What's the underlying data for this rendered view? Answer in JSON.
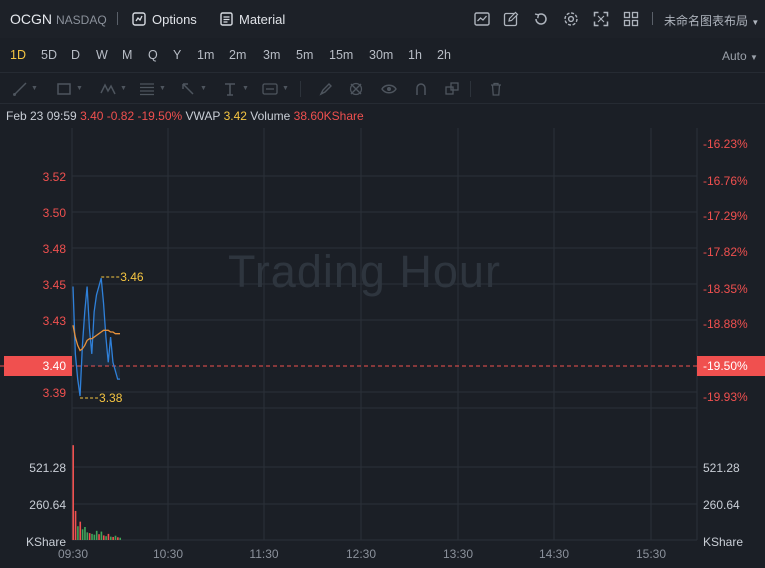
{
  "header": {
    "ticker": "OCGN",
    "exchange": "NASDAQ",
    "options_label": "Options",
    "material_label": "Material",
    "layout_name": "未命名图表布局"
  },
  "toolbar_icons": [
    "indicator-icon",
    "edit-icon",
    "replay-icon",
    "settings-icon",
    "fullscreen-icon",
    "grid-layout-icon"
  ],
  "periods": [
    {
      "label": "1D",
      "active": true
    },
    {
      "label": "5D"
    },
    {
      "label": "D"
    },
    {
      "label": "W"
    },
    {
      "label": "M"
    },
    {
      "label": "Q"
    },
    {
      "label": "Y"
    },
    {
      "label": "1m"
    },
    {
      "label": "2m"
    },
    {
      "label": "3m"
    },
    {
      "label": "5m"
    },
    {
      "label": "15m"
    },
    {
      "label": "30m"
    },
    {
      "label": "1h"
    },
    {
      "label": "2h"
    }
  ],
  "auto_label": "Auto",
  "quote": {
    "datetime": "Feb 23 09:59",
    "price": "3.40",
    "change": "-0.82",
    "change_pct": "-19.50%",
    "vwap_label": "VWAP",
    "vwap": "3.42",
    "volume_label": "Volume",
    "volume": "38.60KShare"
  },
  "watermark": "Trading Hour",
  "colors": {
    "price_line": "#2f80d9",
    "vwap_line": "#e8913a",
    "down": "#f0504f",
    "up": "#3fa55a",
    "accent": "#f5c542",
    "grid": "#2b3139"
  },
  "chart_data": {
    "type": "line",
    "price_axis_labels": [
      "3.52",
      "3.50",
      "3.48",
      "3.45",
      "3.43",
      "3.40",
      "3.39"
    ],
    "pct_axis_labels": [
      "-16.23%",
      "-16.76%",
      "-17.29%",
      "-17.82%",
      "-18.35%",
      "-18.88%",
      "-19.50%",
      "-19.93%"
    ],
    "current_price": "3.40",
    "current_pct": "-19.50%",
    "high_marker": "3.46",
    "low_marker": "3.38",
    "time_labels": [
      "09:30",
      "10:30",
      "11:30",
      "12:30",
      "13:30",
      "14:30",
      "15:30"
    ],
    "volume_axis_labels": [
      "521.28",
      "260.64",
      "KShare"
    ],
    "price_series": [
      [
        0,
        3.455
      ],
      [
        1,
        3.415
      ],
      [
        2,
        3.4
      ],
      [
        3,
        3.39
      ],
      [
        4,
        3.42
      ],
      [
        5,
        3.44
      ],
      [
        6,
        3.455
      ],
      [
        7,
        3.43
      ],
      [
        8,
        3.415
      ],
      [
        9,
        3.44
      ],
      [
        10,
        3.45
      ],
      [
        11,
        3.455
      ],
      [
        12,
        3.46
      ],
      [
        13,
        3.445
      ],
      [
        14,
        3.425
      ],
      [
        15,
        3.41
      ],
      [
        16,
        3.425
      ],
      [
        17,
        3.41
      ],
      [
        18,
        3.405
      ],
      [
        19,
        3.4
      ],
      [
        20,
        3.4
      ]
    ],
    "vwap_series": [
      [
        0,
        3.432
      ],
      [
        1,
        3.425
      ],
      [
        2,
        3.42
      ],
      [
        3,
        3.417
      ],
      [
        4,
        3.418
      ],
      [
        5,
        3.42
      ],
      [
        6,
        3.423
      ],
      [
        7,
        3.424
      ],
      [
        8,
        3.424
      ],
      [
        9,
        3.425
      ],
      [
        10,
        3.426
      ],
      [
        11,
        3.427
      ],
      [
        12,
        3.428
      ],
      [
        13,
        3.429
      ],
      [
        14,
        3.429
      ],
      [
        15,
        3.429
      ],
      [
        16,
        3.428
      ],
      [
        17,
        3.428
      ],
      [
        18,
        3.427
      ],
      [
        19,
        3.427
      ],
      [
        20,
        3.427
      ]
    ],
    "volume_series": [
      {
        "m": 0,
        "v": 620,
        "dir": "down"
      },
      {
        "m": 1,
        "v": 190,
        "dir": "down"
      },
      {
        "m": 2,
        "v": 90,
        "dir": "up"
      },
      {
        "m": 3,
        "v": 120,
        "dir": "down"
      },
      {
        "m": 4,
        "v": 70,
        "dir": "up"
      },
      {
        "m": 5,
        "v": 85,
        "dir": "up"
      },
      {
        "m": 6,
        "v": 50,
        "dir": "up"
      },
      {
        "m": 7,
        "v": 45,
        "dir": "down"
      },
      {
        "m": 8,
        "v": 40,
        "dir": "up"
      },
      {
        "m": 9,
        "v": 35,
        "dir": "up"
      },
      {
        "m": 10,
        "v": 60,
        "dir": "up"
      },
      {
        "m": 11,
        "v": 38,
        "dir": "down"
      },
      {
        "m": 12,
        "v": 55,
        "dir": "up"
      },
      {
        "m": 13,
        "v": 30,
        "dir": "down"
      },
      {
        "m": 14,
        "v": 25,
        "dir": "up"
      },
      {
        "m": 15,
        "v": 40,
        "dir": "down"
      },
      {
        "m": 16,
        "v": 22,
        "dir": "up"
      },
      {
        "m": 17,
        "v": 20,
        "dir": "down"
      },
      {
        "m": 18,
        "v": 28,
        "dir": "up"
      },
      {
        "m": 19,
        "v": 18,
        "dir": "down"
      },
      {
        "m": 20,
        "v": 15,
        "dir": "up"
      }
    ]
  }
}
